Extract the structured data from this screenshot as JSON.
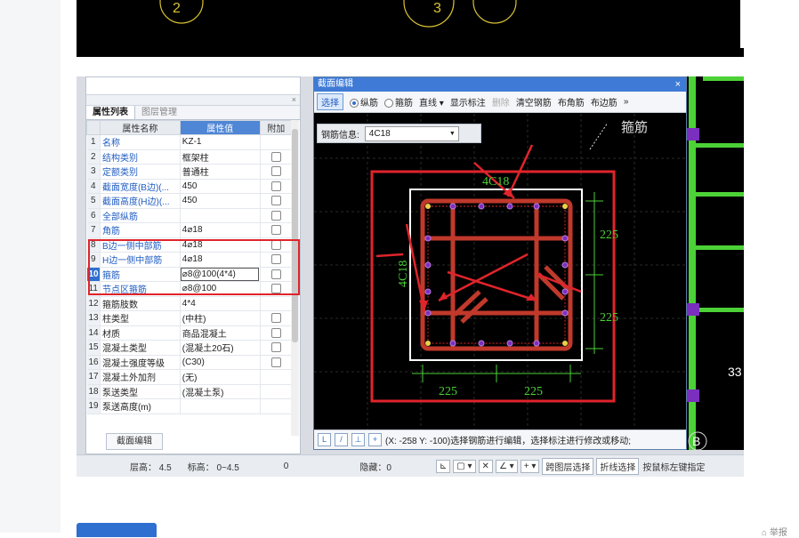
{
  "top_canvas": {
    "circle_labels": [
      "2",
      "3"
    ]
  },
  "properties": {
    "tabs": [
      "属性列表",
      "图层管理"
    ],
    "close": "×",
    "columns": [
      "",
      "属性名称",
      "属性值",
      "附加"
    ],
    "rows": [
      {
        "n": "1",
        "name": "名称",
        "value": "KZ-1",
        "check": false
      },
      {
        "n": "2",
        "name": "结构类别",
        "value": "框架柱",
        "check": true
      },
      {
        "n": "3",
        "name": "定额类别",
        "value": "普通柱",
        "check": true
      },
      {
        "n": "4",
        "name": "截面宽度(B边)(...",
        "value": "450",
        "check": true
      },
      {
        "n": "5",
        "name": "截面高度(H边)(...",
        "value": "450",
        "check": true
      },
      {
        "n": "6",
        "name": "全部纵筋",
        "value": "",
        "check": true
      },
      {
        "n": "7",
        "name": "角筋",
        "value": "4⌀18",
        "check": true
      },
      {
        "n": "8",
        "name": "B边一侧中部筋",
        "value": "4⌀18",
        "check": true
      },
      {
        "n": "9",
        "name": "H边一侧中部筋",
        "value": "4⌀18",
        "check": true
      },
      {
        "n": "10",
        "name": "箍筋",
        "value": "⌀8@100(4*4)",
        "check": true
      },
      {
        "n": "11",
        "name": "节点区箍筋",
        "value": "⌀8@100",
        "check": true
      },
      {
        "n": "12",
        "name": "箍筋肢数",
        "value": "4*4",
        "check": false
      },
      {
        "n": "13",
        "name": "柱类型",
        "value": "(中柱)",
        "check": true
      },
      {
        "n": "14",
        "name": "材质",
        "value": "商品混凝土",
        "check": true
      },
      {
        "n": "15",
        "name": "混凝土类型",
        "value": "(混凝土20石)",
        "check": true
      },
      {
        "n": "16",
        "name": "混凝土强度等级",
        "value": "(C30)",
        "check": true
      },
      {
        "n": "17",
        "name": "混凝土外加剂",
        "value": "(无)",
        "check": false
      },
      {
        "n": "18",
        "name": "泵送类型",
        "value": "(混凝土泵)",
        "check": false
      },
      {
        "n": "19",
        "name": "泵送高度(m)",
        "value": "",
        "check": false
      }
    ],
    "edit_button": "截面编辑"
  },
  "editor": {
    "title": "截面编辑",
    "close": "×",
    "toolbar": {
      "select": "选择",
      "radio_long": "纵筋",
      "radio_stirrup": "箍筋",
      "line": "直线 ▾",
      "show_label": "显示标注",
      "delete": "删除",
      "clear": "清空钢筋",
      "corner": "布角筋",
      "edge": "布边筋",
      "more": "»"
    },
    "info_label": "钢筋信息:",
    "info_value": "4C18",
    "drawing": {
      "label_stirrup": "箍筋",
      "label_top": "4C18",
      "label_left": "4C18",
      "dim_right_top": "225",
      "dim_right_bottom": "225",
      "dim_bottom_left": "225",
      "dim_bottom_right": "225"
    },
    "status_text": "(X: -258 Y: -100)选择钢筋进行编辑，选择标注进行修改或移动;",
    "status_icons": [
      "L",
      "/",
      "⊥",
      "+"
    ]
  },
  "cad_right": {
    "axis_label": "B",
    "dim": "33"
  },
  "statusbar": {
    "floor": "层高： 4.5",
    "elevation": "标高： 0~4.5",
    "zero": "0",
    "hidden": "隐藏：0",
    "cross_layer": "跨图层选择",
    "polyline": "折线选择",
    "hint": "按鼠标左键指定"
  },
  "page": {
    "bottom_right": "⌂ 举报"
  },
  "colors": {
    "accent": "#2f6fd0",
    "highlight": "#e0242b",
    "rebar": "#e0242b",
    "dim": "#4cd137"
  }
}
